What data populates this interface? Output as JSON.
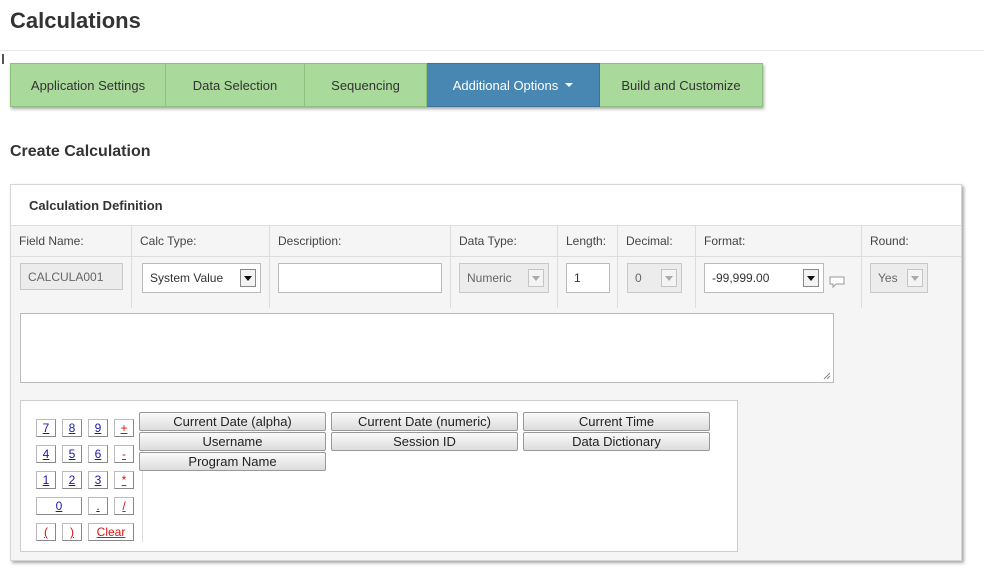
{
  "page": {
    "title": "Calculations"
  },
  "tabs": [
    {
      "label": "Application Settings",
      "active": false
    },
    {
      "label": "Data Selection",
      "active": false
    },
    {
      "label": "Sequencing",
      "active": false
    },
    {
      "label": "Additional Options",
      "active": true,
      "has_caret": true
    },
    {
      "label": "Build and Customize",
      "active": false
    }
  ],
  "section": {
    "title": "Create Calculation"
  },
  "panel": {
    "title": "Calculation Definition",
    "columns": {
      "field_name": {
        "label": "Field Name:",
        "value": "CALCULA001"
      },
      "calc_type": {
        "label": "Calc Type:",
        "value": "System Value"
      },
      "description": {
        "label": "Description:",
        "value": ""
      },
      "data_type": {
        "label": "Data Type:",
        "value": "Numeric"
      },
      "length": {
        "label": "Length:",
        "value": "1"
      },
      "decimal": {
        "label": "Decimal:",
        "value": "0"
      },
      "format": {
        "label": "Format:",
        "value": "-99,999.00"
      },
      "round": {
        "label": "Round:",
        "value": "Yes"
      }
    },
    "expression": {
      "value": ""
    }
  },
  "keypad": {
    "keys": [
      "7",
      "8",
      "9",
      "+",
      "4",
      "5",
      "6",
      "-",
      "1",
      "2",
      "3",
      "*",
      "0",
      ".",
      "/",
      "(",
      ")",
      "Clear"
    ]
  },
  "system_values": [
    "Current Date (alpha)",
    "Current Date (numeric)",
    "Current Time",
    "Username",
    "Session ID",
    "Data Dictionary",
    "Program Name"
  ],
  "colors": {
    "tab_green": "#a9d99b",
    "tab_active": "#4787b2",
    "operator_red": "#dd1111",
    "digit_blue": "#1a1aa8"
  }
}
